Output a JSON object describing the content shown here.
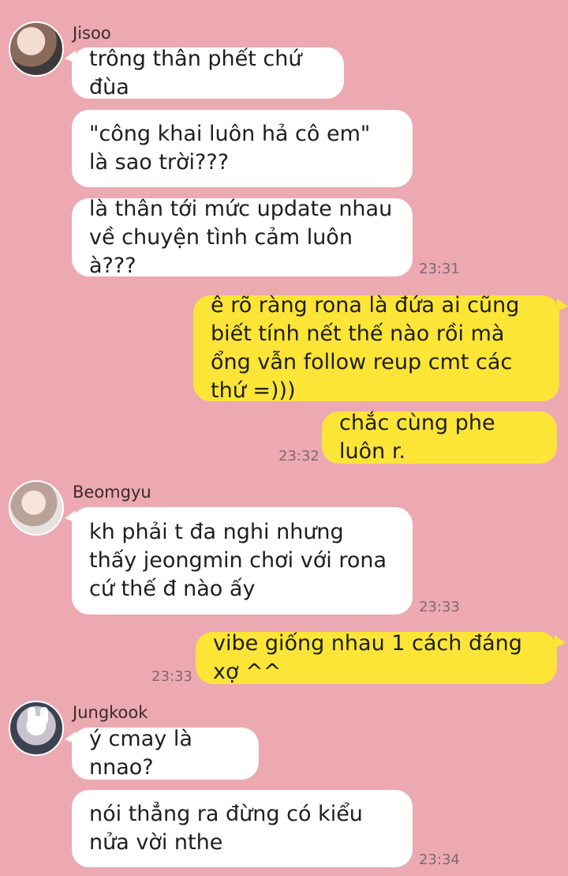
{
  "colors": {
    "background": "#eca9b2",
    "incoming_bubble": "#ffffff",
    "outgoing_bubble": "#fde537"
  },
  "messages": {
    "jisoo_name": "Jisoo",
    "m1": "trông thân phết chứ đùa",
    "m2": "\"công khai luôn hả cô em\" là sao trời???",
    "m3": "là thân tới mức update nhau về chuyện tình cảm luôn à???",
    "t1": "23:31",
    "m4": "ê rõ ràng rona là đứa ai cũng biết tính nết thế nào rồi mà ổng vẫn follow reup cmt các thứ =)))",
    "m5": "chắc cùng phe luôn r.",
    "t2": "23:32",
    "beomgyu_name": "Beomgyu",
    "m6": "kh phải t đa nghi nhưng thấy jeongmin chơi với rona cứ thế đ nào ấy",
    "t3": "23:33",
    "m7": "vibe giống nhau 1 cách đáng xợ ^^",
    "t4": "23:33",
    "jungkook_name": "Jungkook",
    "m8": "ý cmay là nnao?",
    "m9": "nói thẳng ra đừng có kiểu nửa vời nthe",
    "t5": "23:34"
  }
}
